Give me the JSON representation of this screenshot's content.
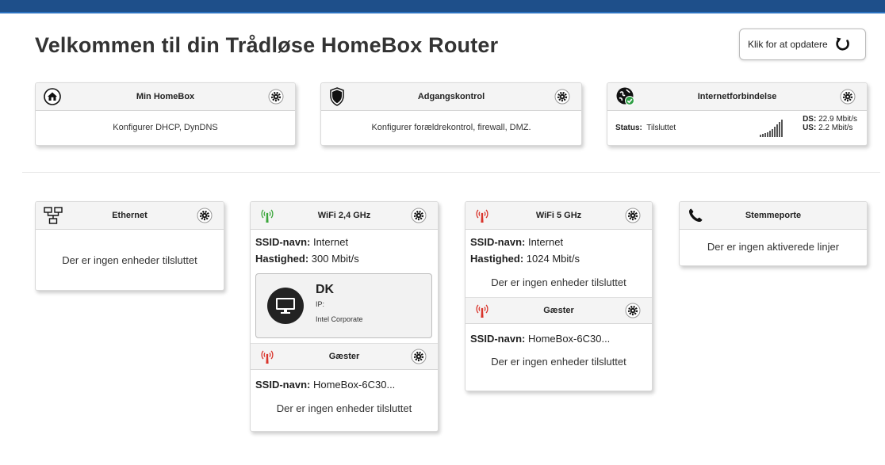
{
  "header": {
    "title": "Velkommen til din Trådløse HomeBox Router",
    "refresh_label": "Klik for at opdatere"
  },
  "top_cards": {
    "homebox": {
      "title": "Min HomeBox",
      "description": "Konfigurer DHCP, DynDNS"
    },
    "access": {
      "title": "Adgangskontrol",
      "description": "Konfigurer forældrekontrol, firewall, DMZ."
    },
    "internet": {
      "title": "Internetforbindelse",
      "status_label": "Status:",
      "status_value": "Tilsluttet",
      "ds_label": "DS:",
      "ds_value": "22.9 Mbit/s",
      "us_label": "US:",
      "us_value": "2.2 Mbit/s"
    }
  },
  "ethernet": {
    "title": "Ethernet",
    "empty_text": "Der er ingen enheder tilsluttet"
  },
  "wifi24": {
    "title": "WiFi 2,4 GHz",
    "ssid_label": "SSID-navn:",
    "ssid_value": "Internet",
    "speed_label": "Hastighed:",
    "speed_value": "300 Mbit/s",
    "device": {
      "name": "DK",
      "ip_label": "IP:",
      "vendor": "Intel Corporate"
    },
    "guest": {
      "title": "Gæster",
      "ssid_label": "SSID-navn:",
      "ssid_value": "HomeBox-6C30...",
      "empty_text": "Der er ingen enheder tilsluttet"
    }
  },
  "wifi5": {
    "title": "WiFi 5 GHz",
    "ssid_label": "SSID-navn:",
    "ssid_value": "Internet",
    "speed_label": "Hastighed:",
    "speed_value": "1024 Mbit/s",
    "empty_text": "Der er ingen enheder tilsluttet",
    "guest": {
      "title": "Gæster",
      "ssid_label": "SSID-navn:",
      "ssid_value": "HomeBox-6C30...",
      "empty_text": "Der er ingen enheder tilsluttet"
    }
  },
  "voice": {
    "title": "Stemmeporte",
    "empty_text": "Der er ingen aktiverede linjer"
  },
  "icons": {
    "refresh": "refresh-icon",
    "house": "house-icon",
    "shield": "shield-icon",
    "globe": "globe-check-icon",
    "network": "network-icon",
    "antenna": "antenna-icon",
    "phone": "phone-icon",
    "gear": "gear-icon",
    "monitor": "monitor-icon",
    "signal": "signal-bars-icon"
  },
  "colors": {
    "topbar": "#1e4f8a",
    "antenna_active": "#3aa63a",
    "antenna_inactive": "#d9342b",
    "connected_check": "#2e9e44"
  },
  "internet_signal_level": 1.0
}
